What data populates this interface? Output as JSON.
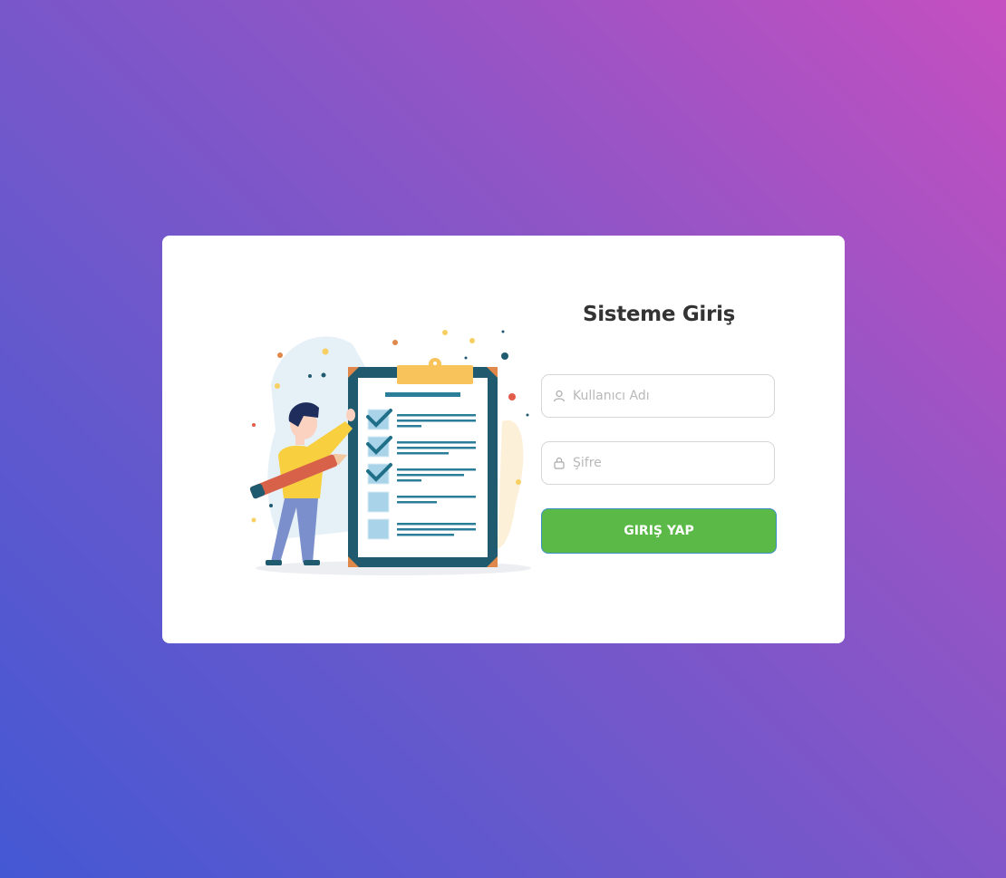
{
  "login": {
    "title": "Sisteme Giriş",
    "username": {
      "placeholder": "Kullanıcı Adı",
      "value": "",
      "icon": "user-icon"
    },
    "password": {
      "placeholder": "Şifre",
      "value": "",
      "icon": "lock-icon"
    },
    "submit_label": "GIRIŞ YAP"
  },
  "colors": {
    "button": "#5bb947",
    "title": "#333333",
    "clipboard": "#1f5a6e"
  }
}
